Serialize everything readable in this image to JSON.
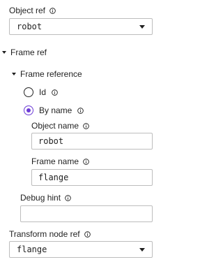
{
  "object_ref": {
    "label": "Object ref",
    "value": "robot"
  },
  "frame_ref": {
    "label": "Frame ref",
    "frame_reference": {
      "label": "Frame reference",
      "options": [
        {
          "label": "Id",
          "selected": false
        },
        {
          "label": "By name",
          "selected": true
        }
      ],
      "object_name": {
        "label": "Object name",
        "value": "robot"
      },
      "frame_name": {
        "label": "Frame name",
        "value": "flange"
      }
    },
    "debug_hint": {
      "label": "Debug hint",
      "value": ""
    }
  },
  "transform_node_ref": {
    "label": "Transform node ref",
    "value": "flange"
  },
  "colors": {
    "accent": "#6c3bd6",
    "border": "#bdbdbd"
  }
}
